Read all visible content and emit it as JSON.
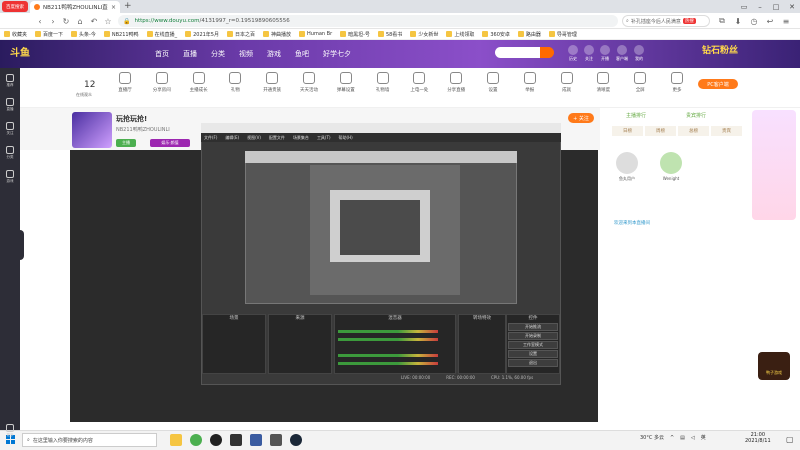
{
  "browser": {
    "logo_label": "百度搜索",
    "tab_title": "NB211鸭鸭ZHOULINLI直播",
    "tab_close": "×",
    "new_tab": "+",
    "url_prefix": "https://www.douyu.com",
    "url_path": "/4131997_r=0.19519890605556",
    "search_text": "补孔插座今后人民满意",
    "search_hot": "热搜",
    "bookmarks": [
      "收藏夹",
      "百度一下",
      "头条-今",
      "NB211鸭鸭",
      "在线直播_",
      "2021年5月",
      "日本之百",
      "神曲播放",
      "Human Br",
      "暗黑坦-号",
      "58看书",
      "少女新世",
      "上线领取",
      "360安卓",
      "路由器",
      "导哥管理"
    ]
  },
  "douyu": {
    "logo": "斗鱼",
    "nav": [
      "首页",
      "直播",
      "分类",
      "视频",
      "游戏",
      "鱼吧",
      "好学七夕"
    ],
    "header_icons": [
      "历史",
      "关注",
      "开播",
      "客户端",
      "我的"
    ],
    "brand_right": "钻石粉丝",
    "side_items": [
      "推荐",
      "直播",
      "关注",
      "分类",
      "游戏",
      "更多"
    ],
    "count": "12",
    "count_label": "在线观众",
    "tools": [
      "直播厅",
      "分享房间",
      "主播成长",
      "礼物",
      "开通贵族",
      "天天活动",
      "弹幕设置",
      "礼物墙",
      "上电一处",
      "分享直播",
      "设置",
      "举报",
      "成就",
      "清晰度",
      "全屏",
      "更多"
    ],
    "pc_button": "PC客户端",
    "room_title": "玩抢玩抢!",
    "room_name": "NB211鸭鸭ZHOULINLI",
    "tag_1": "主播",
    "tag_2": "娱乐·颜值",
    "follow": "+ 关注",
    "right_tabs": [
      "主播排行",
      "贵宾排行"
    ],
    "right_sub": [
      "日榜",
      "周榜",
      "总榜",
      "贵宾"
    ],
    "fans": [
      "鱼丸用户",
      "Wenight"
    ],
    "chat_line": "欢迎来到本直播间",
    "ad_label": "鸭子游戏"
  },
  "obs": {
    "menu": [
      "文件(F)",
      "编辑(E)",
      "视图(V)",
      "配置文件",
      "场景集合",
      "工具(T)",
      "帮助(H)"
    ],
    "docks": [
      "场景",
      "来源",
      "混音器",
      "转场特效",
      "控件"
    ],
    "controls": [
      "开始推流",
      "开始录制",
      "工作室模式",
      "设置",
      "退出"
    ],
    "status": [
      "LIVE: 00:00:00",
      "REC: 00:00:00",
      "CPU: 1.1%, 60.00 fps"
    ]
  },
  "taskbar": {
    "search_placeholder": "在这里输入你要搜索的内容",
    "weather": "30°C 多云",
    "ime": "英",
    "time": "21:00",
    "date": "2021/8/11"
  },
  "colors": {
    "accent": "#ff7a1a",
    "header_purple": "#6a3aa8",
    "obs_bg": "#2b2b2b",
    "url_green": "#15803d"
  }
}
